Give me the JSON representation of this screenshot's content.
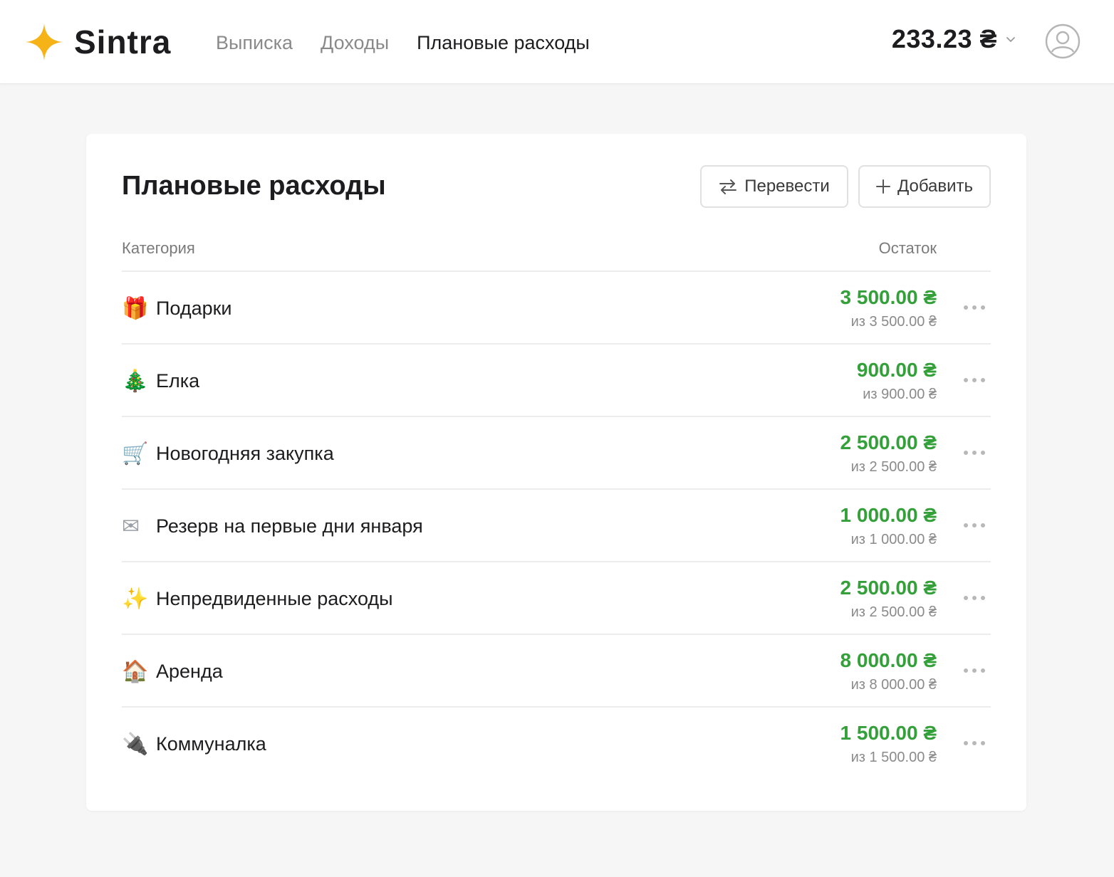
{
  "header": {
    "brand": "Sintra",
    "nav": [
      {
        "label": "Выписка",
        "active": false
      },
      {
        "label": "Доходы",
        "active": false
      },
      {
        "label": "Плановые расходы",
        "active": true
      }
    ],
    "balance": "233.23 ₴"
  },
  "page": {
    "title": "Плановые расходы",
    "transfer_label": "Перевести",
    "add_label": "Добавить",
    "col_category": "Категория",
    "col_remaining": "Остаток"
  },
  "rows": [
    {
      "emoji": "🎁",
      "name": "Подарки",
      "remaining": "3 500.00 ₴",
      "total": "из 3 500.00 ₴"
    },
    {
      "emoji": "🎄",
      "name": "Елка",
      "remaining": "900.00 ₴",
      "total": "из 900.00 ₴"
    },
    {
      "emoji": "🛒",
      "name": "Новогодняя закупка",
      "remaining": "2 500.00 ₴",
      "total": "из 2 500.00 ₴"
    },
    {
      "emoji": "✉",
      "name": "Резерв на первые дни января",
      "remaining": "1 000.00 ₴",
      "total": "из 1 000.00 ₴"
    },
    {
      "emoji": "✨",
      "name": "Непредвиденные расходы",
      "remaining": "2 500.00 ₴",
      "total": "из 2 500.00 ₴"
    },
    {
      "emoji": "🏠",
      "name": "Аренда",
      "remaining": "8 000.00 ₴",
      "total": "из 8 000.00 ₴"
    },
    {
      "emoji": "🔌",
      "name": "Коммуналка",
      "remaining": "1 500.00 ₴",
      "total": "из 1 500.00 ₴"
    }
  ],
  "colors": {
    "accent": "#f5b317",
    "positive": "#34a039",
    "muted": "#8a8a8a"
  },
  "icons": {
    "logo": "star-icon",
    "transfer": "swap-arrows-icon",
    "add": "plus-icon",
    "balance_dropdown": "chevron-down-icon",
    "avatar": "user-circle-icon",
    "row_menu": "more-horizontal-icon"
  }
}
